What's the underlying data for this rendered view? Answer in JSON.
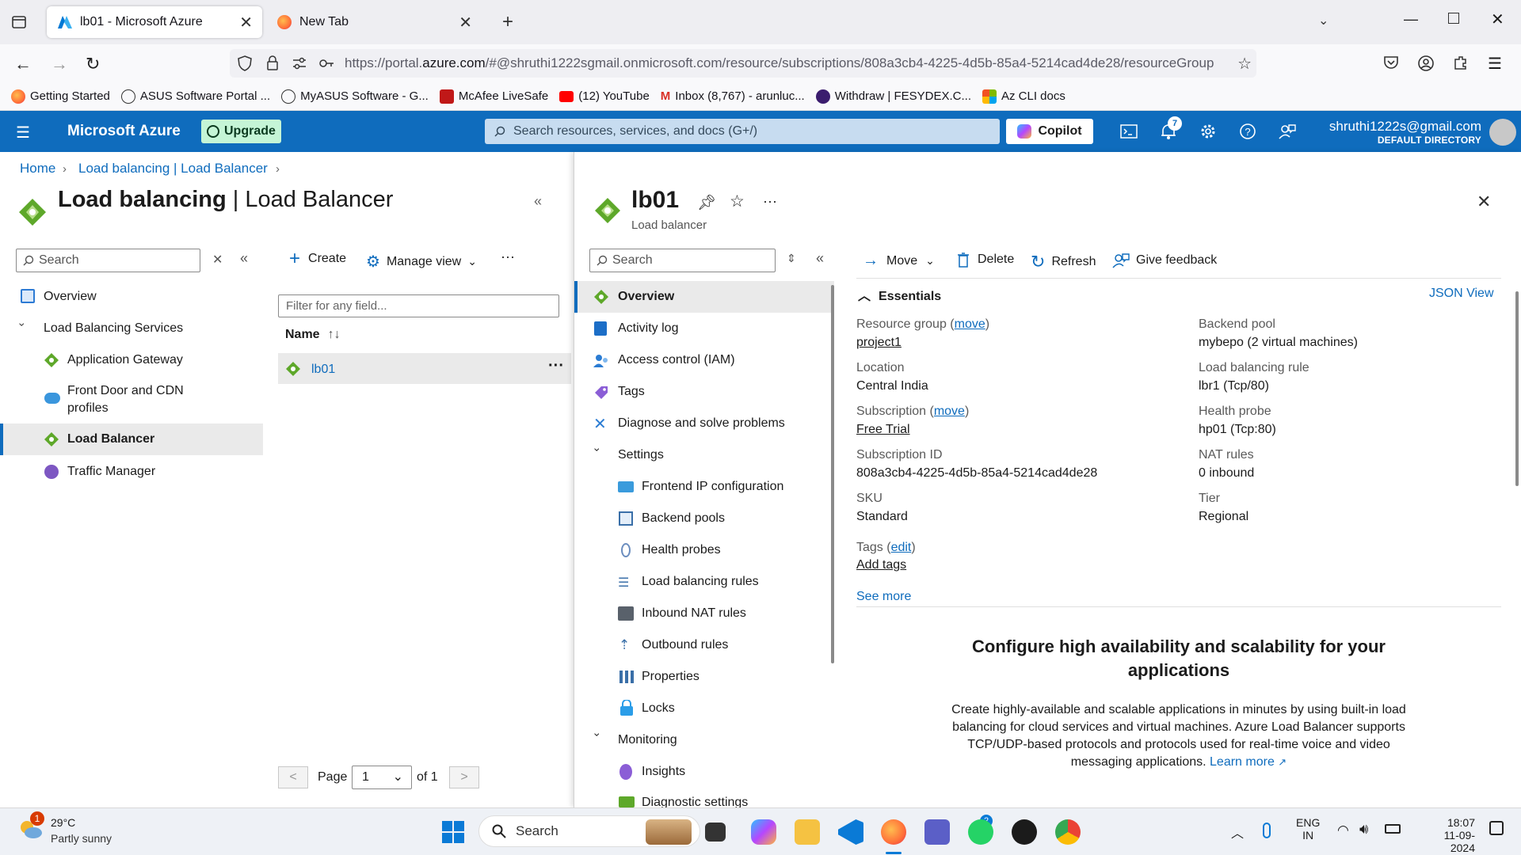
{
  "browser": {
    "tabs": [
      {
        "label": "lb01 - Microsoft Azure"
      },
      {
        "label": "New Tab"
      }
    ],
    "url_prefix": "https://portal.",
    "url_domain": "azure.com",
    "url_rest": "/#@shruthi1222sgmail.onmicrosoft.com/resource/subscriptions/808a3cb4-4225-4d5b-85a4-5214cad4de28/resourceGroup",
    "bookmarks": [
      "Getting Started",
      "ASUS Software Portal ...",
      "MyASUS Software - G...",
      "McAfee LiveSafe",
      "(12) YouTube",
      "Inbox (8,767) - arunluc...",
      "Withdraw | FESYDEX.C...",
      "Az CLI docs"
    ]
  },
  "azure": {
    "brand": "Microsoft Azure",
    "upgrade": "Upgrade",
    "search_placeholder": "Search resources, services, and docs (G+/)",
    "copilot": "Copilot",
    "notification_count": "7",
    "user_email": "shruthi1222s@gmail.com",
    "user_directory": "DEFAULT DIRECTORY"
  },
  "breadcrumb": [
    "Home",
    "Load balancing | Load Balancer"
  ],
  "left": {
    "title_bold": "Load balancing",
    "title_rest": " | Load Balancer",
    "search_placeholder": "Search",
    "nav": {
      "overview": "Overview",
      "group": "Load Balancing Services",
      "app_gateway": "Application Gateway",
      "front_door_1": "Front Door and CDN",
      "front_door_2": "profiles",
      "load_balancer": "Load Balancer",
      "traffic_manager": "Traffic Manager"
    }
  },
  "list": {
    "create": "Create",
    "manage_view": "Manage view",
    "filter_placeholder": "Filter for any field...",
    "col_name": "Name",
    "rows": [
      {
        "name": "lb01"
      }
    ],
    "page_label": "Page",
    "page_value": "1",
    "of_label": "of 1"
  },
  "resource": {
    "name": "lb01",
    "type": "Load balancer",
    "search_placeholder": "Search",
    "menu": {
      "overview": "Overview",
      "activity_log": "Activity log",
      "iam": "Access control (IAM)",
      "tags": "Tags",
      "diagnose": "Diagnose and solve problems",
      "settings": "Settings",
      "frontend": "Frontend IP configuration",
      "backend": "Backend pools",
      "health": "Health probes",
      "lb_rules": "Load balancing rules",
      "nat": "Inbound NAT rules",
      "outbound": "Outbound rules",
      "properties": "Properties",
      "locks": "Locks",
      "monitoring": "Monitoring",
      "insights": "Insights",
      "diag_settings": "Diagnostic settings"
    },
    "toolbar": {
      "move": "Move",
      "delete": "Delete",
      "refresh": "Refresh",
      "feedback": "Give feedback"
    },
    "essentials_title": "Essentials",
    "json_view": "JSON View",
    "essentials": {
      "rg_label": "Resource group",
      "rg_move": "move",
      "rg_value": "project1",
      "loc_label": "Location",
      "loc_value": "Central India",
      "sub_label": "Subscription",
      "sub_move": "move",
      "sub_value": "Free Trial",
      "subid_label": "Subscription ID",
      "subid_value": "808a3cb4-4225-4d5b-85a4-5214cad4de28",
      "sku_label": "SKU",
      "sku_value": "Standard",
      "tags_label": "Tags",
      "tags_edit": "edit",
      "tags_add": "Add tags",
      "bp_label": "Backend pool",
      "bp_value": "mybepo (2 virtual machines)",
      "lbr_label": "Load balancing rule",
      "lbr_value": "lbr1 (Tcp/80)",
      "hp_label": "Health probe",
      "hp_value": "hp01 (Tcp:80)",
      "nat_label": "NAT rules",
      "nat_value": "0 inbound",
      "tier_label": "Tier",
      "tier_value": "Regional",
      "see_more": "See more"
    },
    "promo_title_1": "Configure high availability and scalability for your",
    "promo_title_2": "applications",
    "promo_lines": [
      "Create highly-available and scalable applications in minutes by using built-in load",
      "balancing for cloud services and virtual machines. Azure Load Balancer supports",
      "TCP/UDP-based protocols and protocols used for real-time voice and video"
    ],
    "promo_last": "messaging applications.",
    "learn_more": "Learn more"
  },
  "taskbar": {
    "temp": "29°C",
    "weather": "Partly sunny",
    "weather_badge": "1",
    "search": "Search",
    "teams_badge": "2",
    "lang1": "ENG",
    "lang2": "IN",
    "time": "18:07",
    "date": "11-09-2024"
  }
}
